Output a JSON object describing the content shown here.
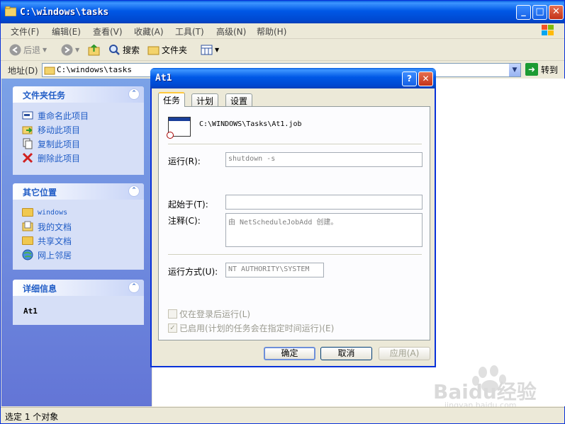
{
  "window": {
    "title": "C:\\windows\\tasks",
    "minimize": "_",
    "maximize": "□",
    "close": "✕"
  },
  "menu": [
    "文件(F)",
    "编辑(E)",
    "查看(V)",
    "收藏(A)",
    "工具(T)",
    "高级(N)",
    "帮助(H)"
  ],
  "toolbar": {
    "back": "后退",
    "search": "搜索",
    "folders": "文件夹"
  },
  "address": {
    "label": "地址(D)",
    "value": "C:\\windows\\tasks",
    "go": "转到"
  },
  "sidebar": {
    "tasks": {
      "title": "文件夹任务",
      "items": [
        "重命名此项目",
        "移动此项目",
        "复制此项目",
        "删除此项目"
      ]
    },
    "places": {
      "title": "其它位置",
      "items": [
        "windows",
        "我的文档",
        "共享文档",
        "网上邻居"
      ]
    },
    "details": {
      "title": "详细信息",
      "name": "At1"
    }
  },
  "status": "选定 1 个对象",
  "dialog": {
    "title": "At1",
    "help": "?",
    "close": "✕",
    "tabs": [
      "任务",
      "计划",
      "设置"
    ],
    "job_path": "C:\\WINDOWS\\Tasks\\At1.job",
    "run_label": "运行(R):",
    "run_value": "shutdown -s",
    "start_in_label": "起始于(T):",
    "start_in_value": "",
    "comment_label": "注释(C):",
    "comment_value": "由 NetScheduleJobAdd 创建。",
    "run_as_label": "运行方式(U):",
    "run_as_value": "NT AUTHORITY\\SYSTEM",
    "check_logon": "仅在登录后运行(L)",
    "check_enabled": "已启用(计划的任务会在指定时间运行)(E)",
    "ok": "确定",
    "cancel": "取消",
    "apply": "应用(A)"
  },
  "watermark": {
    "brand": "Baidu经验",
    "url": "jingyan.baidu.com"
  }
}
